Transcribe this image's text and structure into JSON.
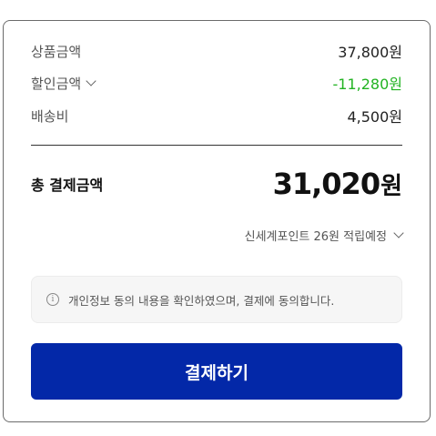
{
  "summary": {
    "product_amount": {
      "label": "상품금액",
      "value": "37,800원"
    },
    "discount_amount": {
      "label": "할인금액",
      "value": "-11,280원",
      "color": "#22b322"
    },
    "shipping_fee": {
      "label": "배송비",
      "value": "4,500원"
    }
  },
  "total": {
    "label": "총 결제금액",
    "amount": "31,020",
    "unit": "원"
  },
  "points": {
    "text": "신세계포인트 26원 적립예정"
  },
  "notice": {
    "icon": "info-icon",
    "text": "개인정보 동의 내용을 확인하였으며, 결제에 동의합니다."
  },
  "pay_button": {
    "label": "결제하기",
    "color": "#0328a8"
  }
}
